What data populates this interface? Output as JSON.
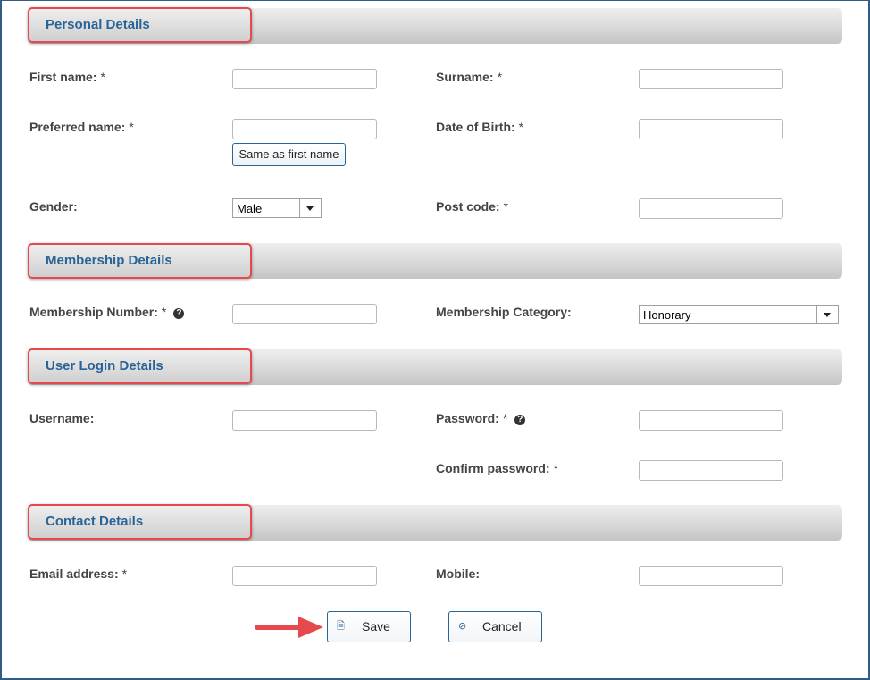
{
  "sections": {
    "personal": "Personal Details",
    "membership": "Membership Details",
    "login": "User Login Details",
    "contact": "Contact Details"
  },
  "fields": {
    "first_name": "First name:",
    "surname": "Surname:",
    "preferred_name": "Preferred name:",
    "dob": "Date of Birth:",
    "gender": "Gender:",
    "post_code": "Post code:",
    "membership_number": "Membership Number:",
    "membership_category": "Membership Category:",
    "username": "Username:",
    "password": "Password:",
    "confirm_password": "Confirm password:",
    "email": "Email address:",
    "mobile": "Mobile:"
  },
  "required_marker": "*",
  "same_as_first_name": "Same as first name",
  "gender_value": "Male",
  "membership_category_value": "Honorary",
  "buttons": {
    "save": "Save",
    "cancel": "Cancel"
  },
  "icons": {
    "help": "question-circle-icon",
    "save": "file-icon",
    "cancel": "ban-icon",
    "annotation": "red-arrow-icon"
  },
  "colors": {
    "section_title": "#2a6496",
    "highlight_border": "#e5484d",
    "frame": "#2f5d86"
  }
}
